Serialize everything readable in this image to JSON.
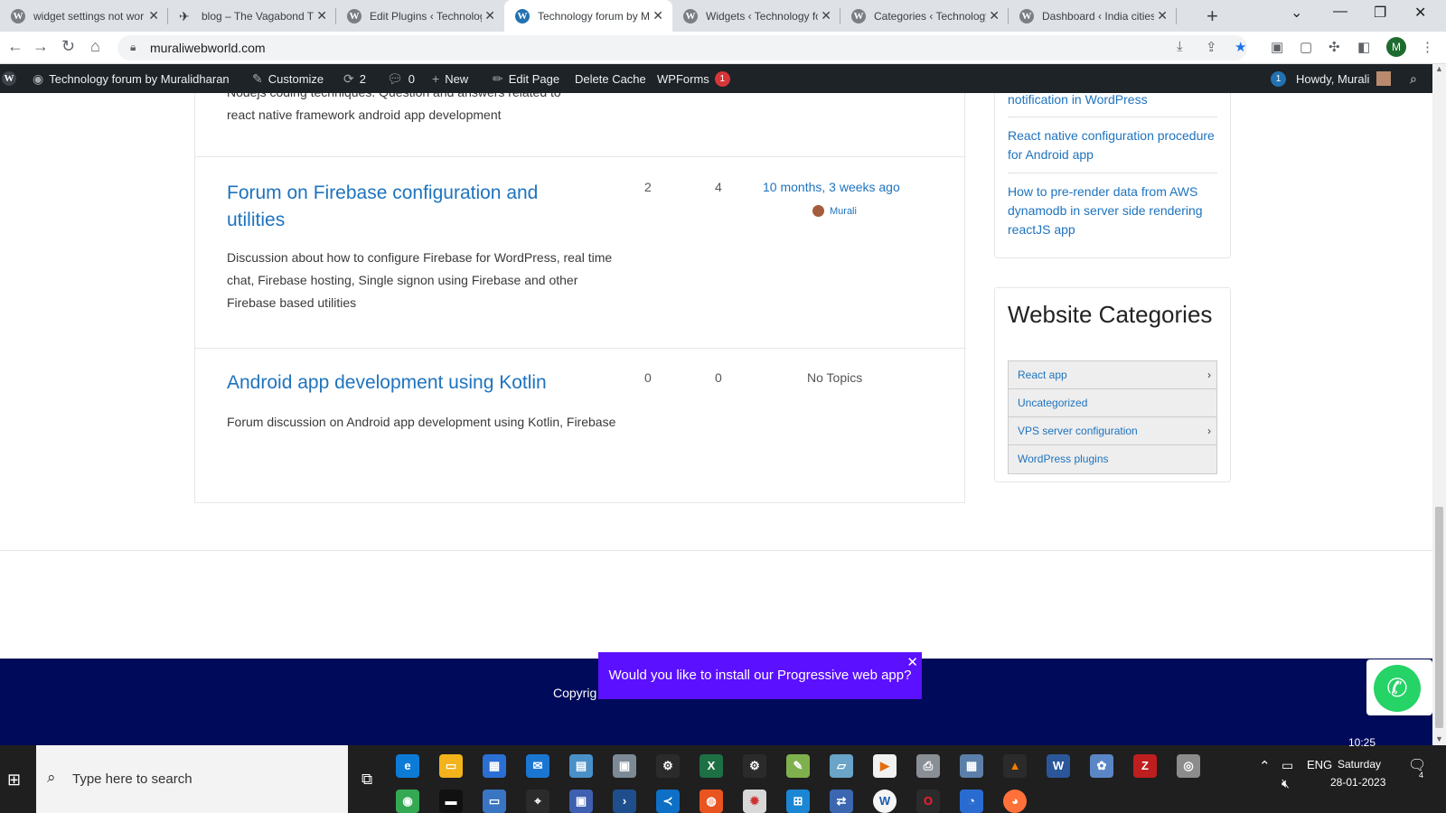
{
  "browser": {
    "tabs": [
      {
        "title": "widget settings not wor"
      },
      {
        "title": "blog – The Vagabond Tr"
      },
      {
        "title": "Edit Plugins ‹ Technolog"
      },
      {
        "title": "Technology forum by M"
      },
      {
        "title": "Widgets ‹ Technology fo"
      },
      {
        "title": "Categories ‹ Technology"
      },
      {
        "title": "Dashboard ‹ India cities"
      }
    ],
    "active_tab": 3,
    "url": "muraliwebworld.com",
    "profile_initial": "M"
  },
  "adminbar": {
    "site_name": "Technology forum by Muralidharan",
    "customize": "Customize",
    "updates_count": "2",
    "comments_count": "0",
    "new": "New",
    "edit_page": "Edit Page",
    "delete_cache": "Delete Cache",
    "wpforms": "WPForms",
    "wpforms_badge": "1",
    "notif_badge": "1",
    "howdy": "Howdy, Murali"
  },
  "forums": {
    "partial_desc_line1": "Nodejs coding techniques. Question and answers related to",
    "partial_desc_line2": "react native framework android app development",
    "rows": [
      {
        "title": "Forum on Firebase configuration and utilities",
        "description": "Discussion about how to configure Firebase for WordPress, real time chat, Firebase hosting, Single signon using Firebase and other Firebase based utilities",
        "topics": "2",
        "posts": "4",
        "freshness": "10 months, 3 weeks ago",
        "author": "Murali"
      },
      {
        "title": "Android app development using Kotlin",
        "description": "Forum discussion on Android app development using Kotlin, Firebase",
        "topics": "0",
        "posts": "0",
        "freshness": "No Topics"
      }
    ]
  },
  "sidebar": {
    "recent_posts": [
      "notification in WordPress",
      "React native configuration procedure for Android app",
      "How to pre-render data from AWS dynamodb in server side rendering reactJS app"
    ],
    "categories_title": "Website Categories",
    "categories": [
      {
        "label": "React app",
        "has_children": true
      },
      {
        "label": "Uncategorized",
        "has_children": false
      },
      {
        "label": "VPS server configuration",
        "has_children": true
      },
      {
        "label": "WordPress plugins",
        "has_children": false
      }
    ]
  },
  "footer": {
    "copyright_visible": "Copyrig"
  },
  "pwa_prompt": {
    "text": "Would you like to install our Progressive web app?"
  },
  "taskbar": {
    "search_placeholder": "Type here to search",
    "language": "ENG",
    "time": "10:25",
    "day": "Saturday",
    "date": "28-01-2023",
    "notification_count": "4"
  }
}
